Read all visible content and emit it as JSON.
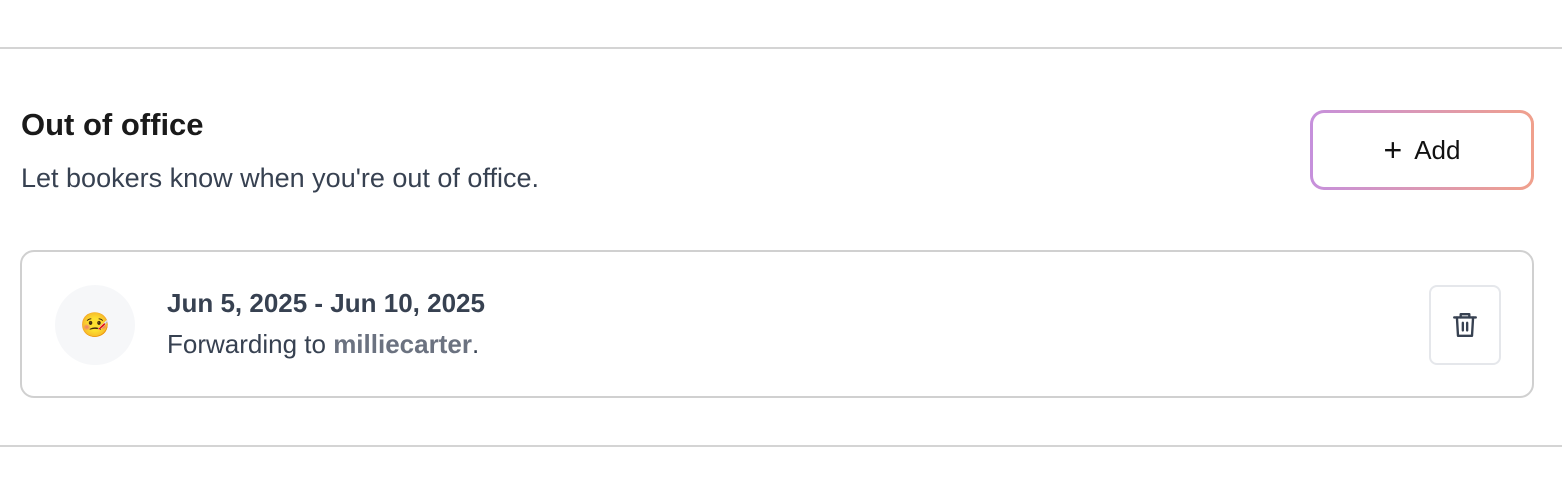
{
  "section": {
    "title": "Out of office",
    "description": "Let bookers know when you're out of office.",
    "add_button": {
      "icon": "plus-icon",
      "label": "Add"
    }
  },
  "entries": [
    {
      "emoji": "🤒",
      "date_range": "Jun 5, 2025 - Jun 10, 2025",
      "forwarding_prefix": "Forwarding to ",
      "forwarding_user": "milliecarter",
      "forwarding_suffix": ".",
      "delete_icon": "trash-icon"
    }
  ],
  "colors": {
    "gradient_start": "#c690dc",
    "gradient_end": "#f0a08c"
  }
}
